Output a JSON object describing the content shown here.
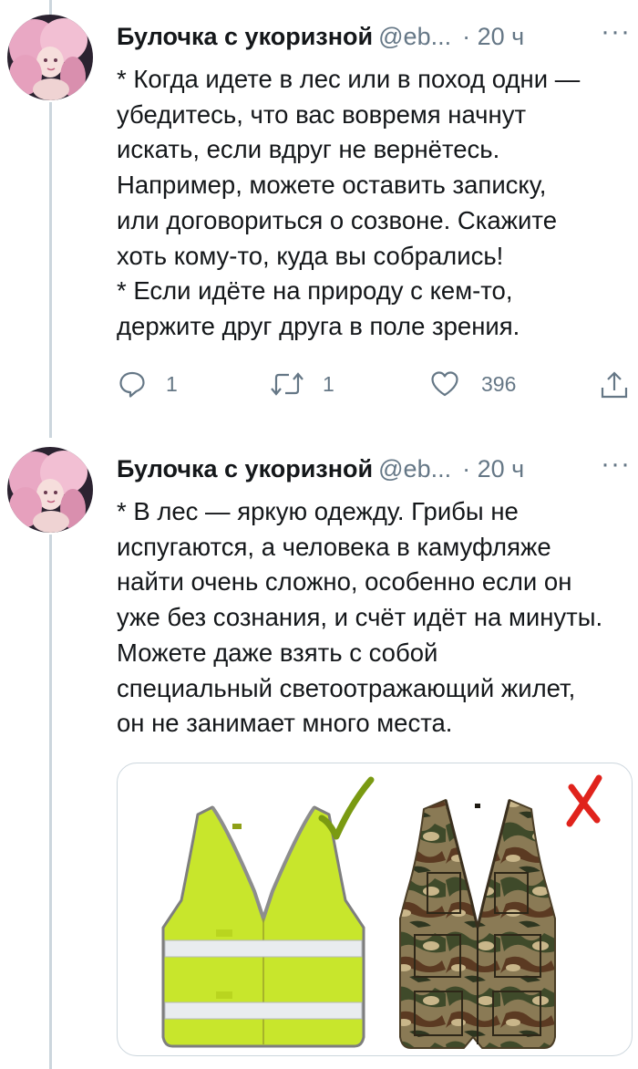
{
  "tweets": [
    {
      "author_name": "Булочка с укоризной",
      "author_handle": "@eb...",
      "time_sep": "·",
      "time": "20 ч",
      "more": "···",
      "lines": [
        "* Когда идете в лес или в поход одни —",
        "убедитесь, что вас вовремя начнут",
        "искать, если вдруг не вернётесь.",
        "Например, можете оставить  записку,",
        "или договориться о созвоне. Скажите",
        "хоть кому-то, куда вы собрались!",
        "* Если идёте на природу с кем-то,",
        "держите друг друга в поле зрения."
      ],
      "actions": {
        "reply_count": "1",
        "retweet_count": "1",
        "like_count": "396"
      }
    },
    {
      "author_name": "Булочка с укоризной",
      "author_handle": "@eb...",
      "time_sep": "·",
      "time": "20 ч",
      "more": "···",
      "lines": [
        "* В лес — яркую одежду. Грибы не",
        "испугаются, а человека в камуфляже",
        "найти очень сложно, особенно если он",
        "уже без сознания, и счёт идёт на минуты.",
        "Можете даже взять с собой",
        "специальный светоотражающий жилет,",
        "он не занимает много места."
      ]
    }
  ],
  "media": {
    "left_item": "reflective-vest",
    "left_mark": "checkmark",
    "right_item": "camouflage-vest",
    "right_mark": "cross",
    "colors": {
      "vest_yellow": "#c8e62c",
      "check_green": "#7a9a12",
      "cross_red": "#e0231c"
    }
  },
  "colors": {
    "text": "#14171a",
    "secondary": "#657786",
    "border": "#ccd6dd"
  }
}
